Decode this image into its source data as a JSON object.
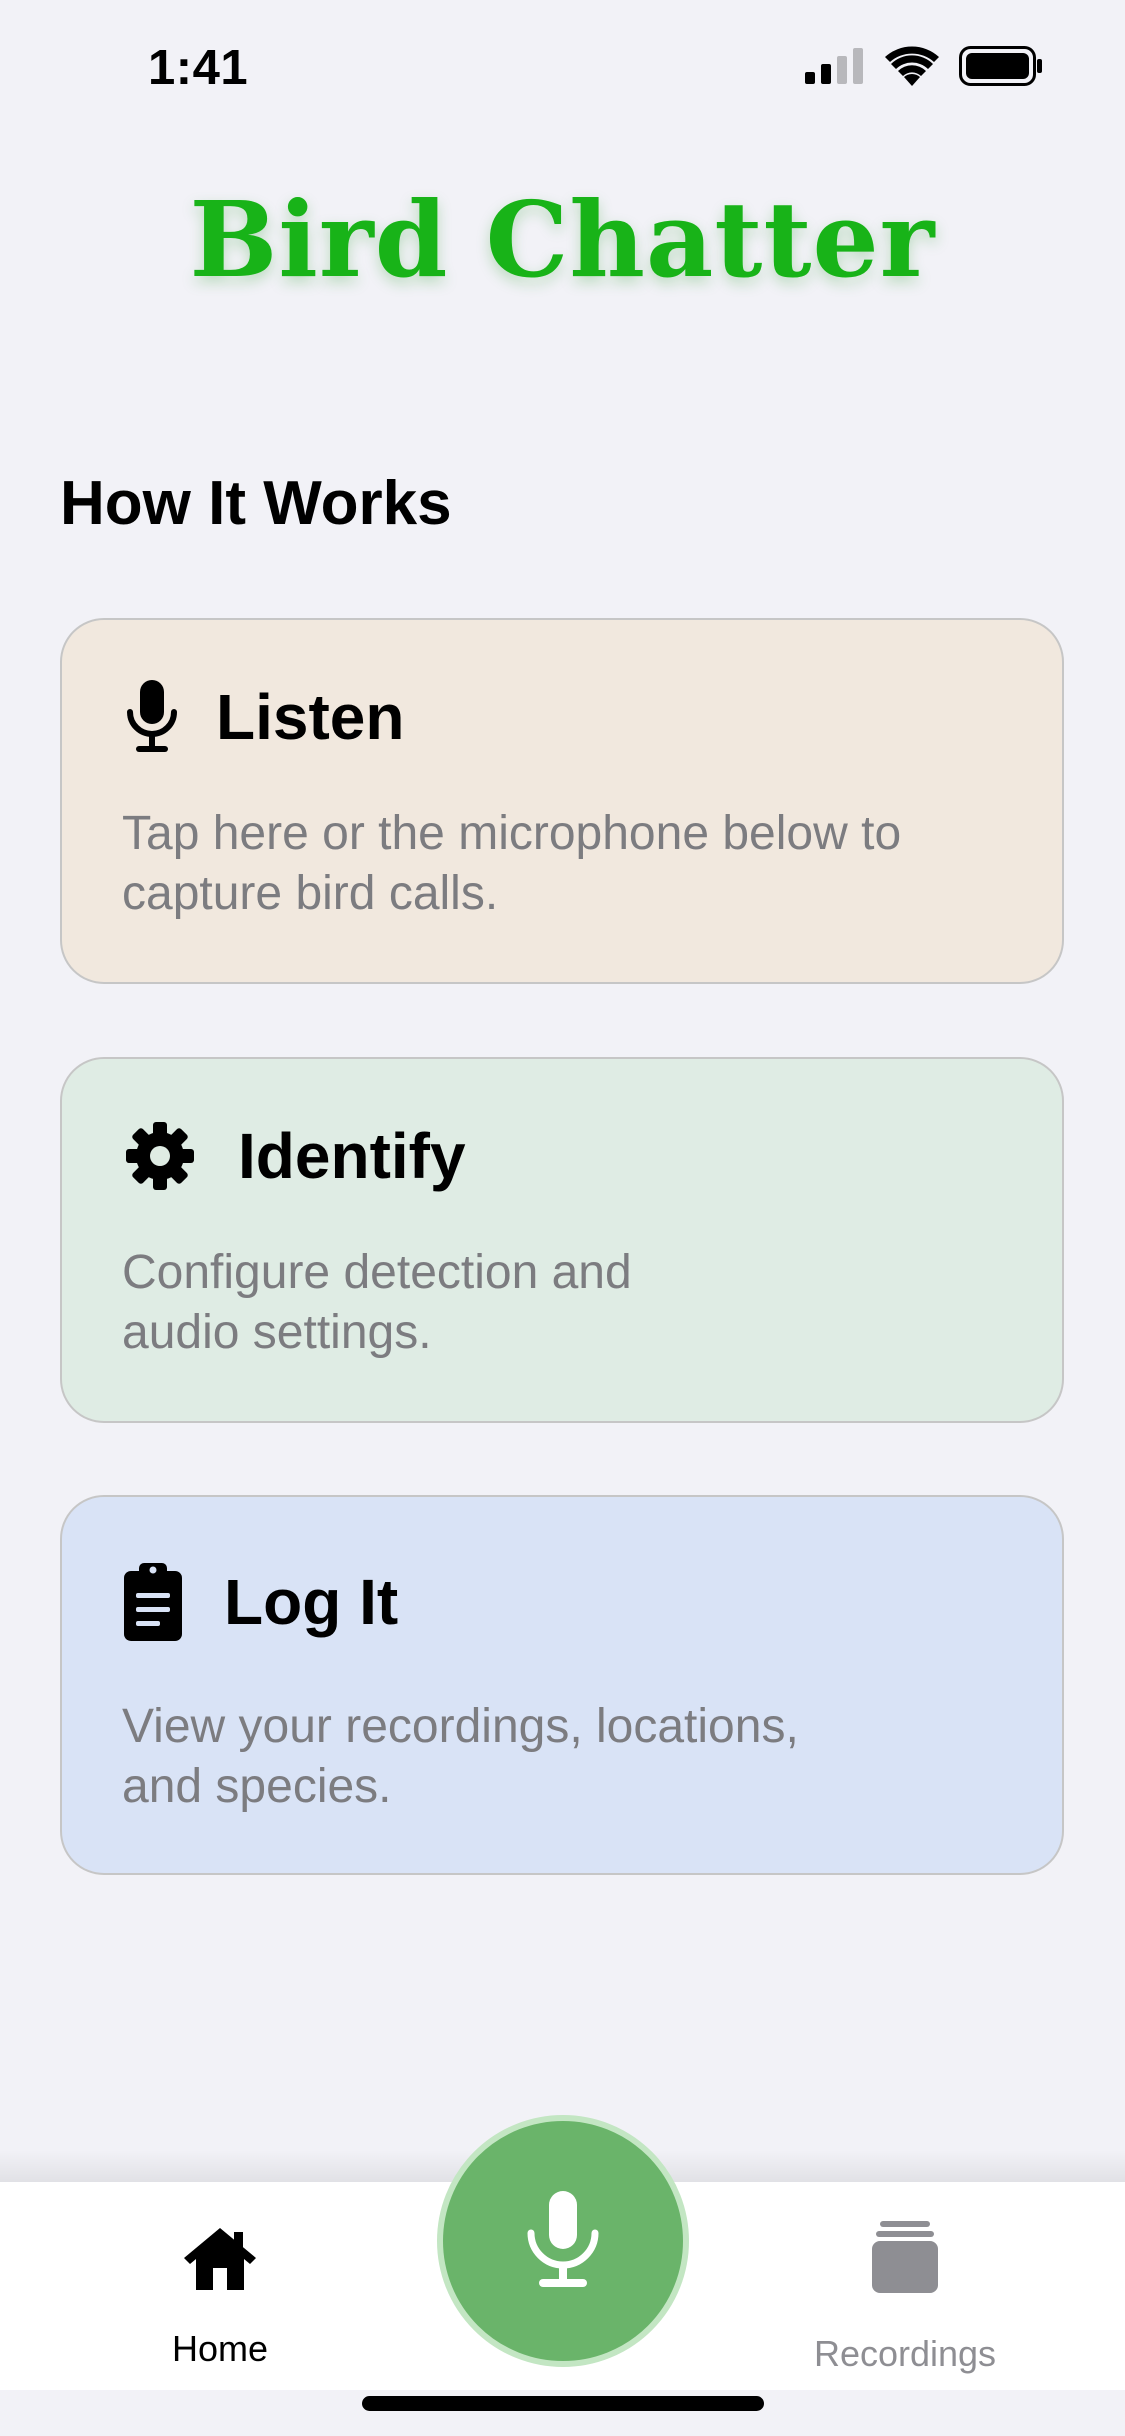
{
  "status_bar": {
    "time": "1:41",
    "icons": [
      "cellular-signal-icon",
      "wifi-icon",
      "battery-icon"
    ]
  },
  "app": {
    "title": "Bird Chatter",
    "title_color": "#18b318"
  },
  "section": {
    "heading": "How It Works"
  },
  "cards": [
    {
      "icon": "microphone-icon",
      "title": "Listen",
      "description": "Tap here or the microphone below to capture bird calls.",
      "background": "#f1e8de"
    },
    {
      "icon": "gear-icon",
      "title": "Identify",
      "description": "Configure detection and audio settings.",
      "background": "#dfece4"
    },
    {
      "icon": "clipboard-icon",
      "title": "Log It",
      "description": "View your recordings, locations, and species.",
      "background": "#d9e3f6"
    }
  ],
  "tab_bar": {
    "home_label": "Home",
    "home_icon": "home-icon",
    "record_icon": "microphone-icon",
    "record_color": "#6ab46a",
    "recordings_label": "Recordings",
    "recordings_icon": "stack-icon",
    "selected": "Home"
  }
}
